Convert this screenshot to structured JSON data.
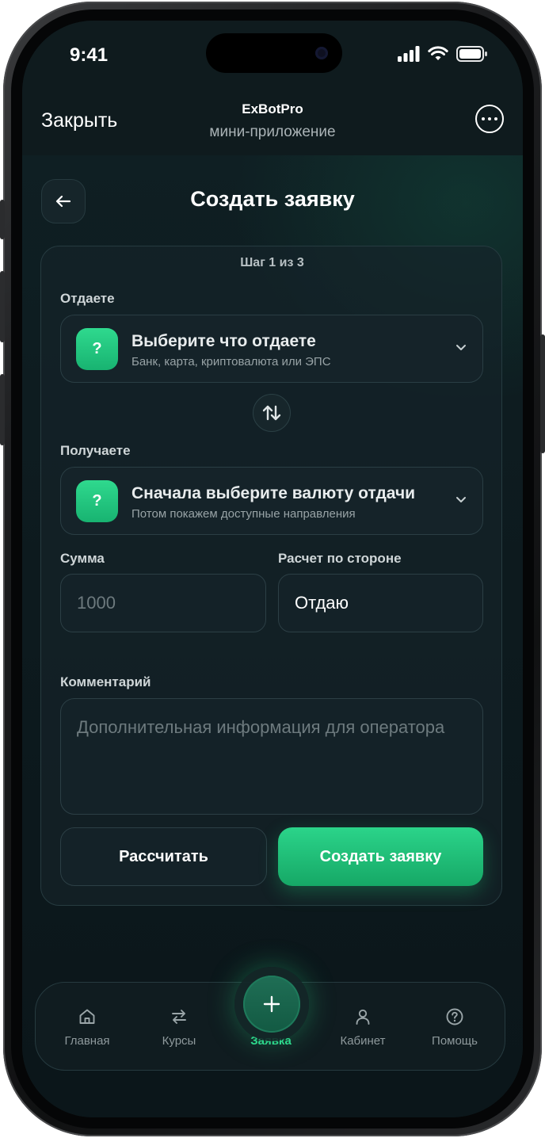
{
  "status_bar": {
    "time": "9:41"
  },
  "header": {
    "close_label": "Закрыть",
    "app_name": "ExBotPro",
    "app_subtitle": "мини-приложение"
  },
  "page": {
    "title": "Создать заявку"
  },
  "form": {
    "step": "Шаг 1 из 3",
    "give": {
      "label": "Отдаете",
      "title": "Выберите что отдаете",
      "subtitle": "Банк, карта, криптовалюта или ЭПС",
      "icon_text": "?"
    },
    "receive": {
      "label": "Получаете",
      "title": "Сначала выберите валюту отдачи",
      "subtitle": "Потом покажем доступные направления",
      "icon_text": "?"
    },
    "amount": {
      "label": "Сумма",
      "placeholder": "1000"
    },
    "side": {
      "label": "Расчет по стороне",
      "value": "Отдаю"
    },
    "comment": {
      "label": "Комментарий",
      "placeholder": "Дополнительная информация для оператора"
    },
    "calculate_label": "Рассчитать",
    "submit_label": "Создать заявку"
  },
  "tabbar": {
    "items": [
      {
        "label": "Главная",
        "icon": "home-icon",
        "active": false
      },
      {
        "label": "Курсы",
        "icon": "exchange-arrows-icon",
        "active": false
      },
      {
        "label": "Заявка",
        "icon": "plus-icon",
        "active": true
      },
      {
        "label": "Кабинет",
        "icon": "user-icon",
        "active": false
      },
      {
        "label": "Помощь",
        "icon": "help-circle-icon",
        "active": false
      }
    ]
  },
  "colors": {
    "accent": "#2fd98e",
    "background": "#0f1c1f",
    "card": "#162429"
  }
}
